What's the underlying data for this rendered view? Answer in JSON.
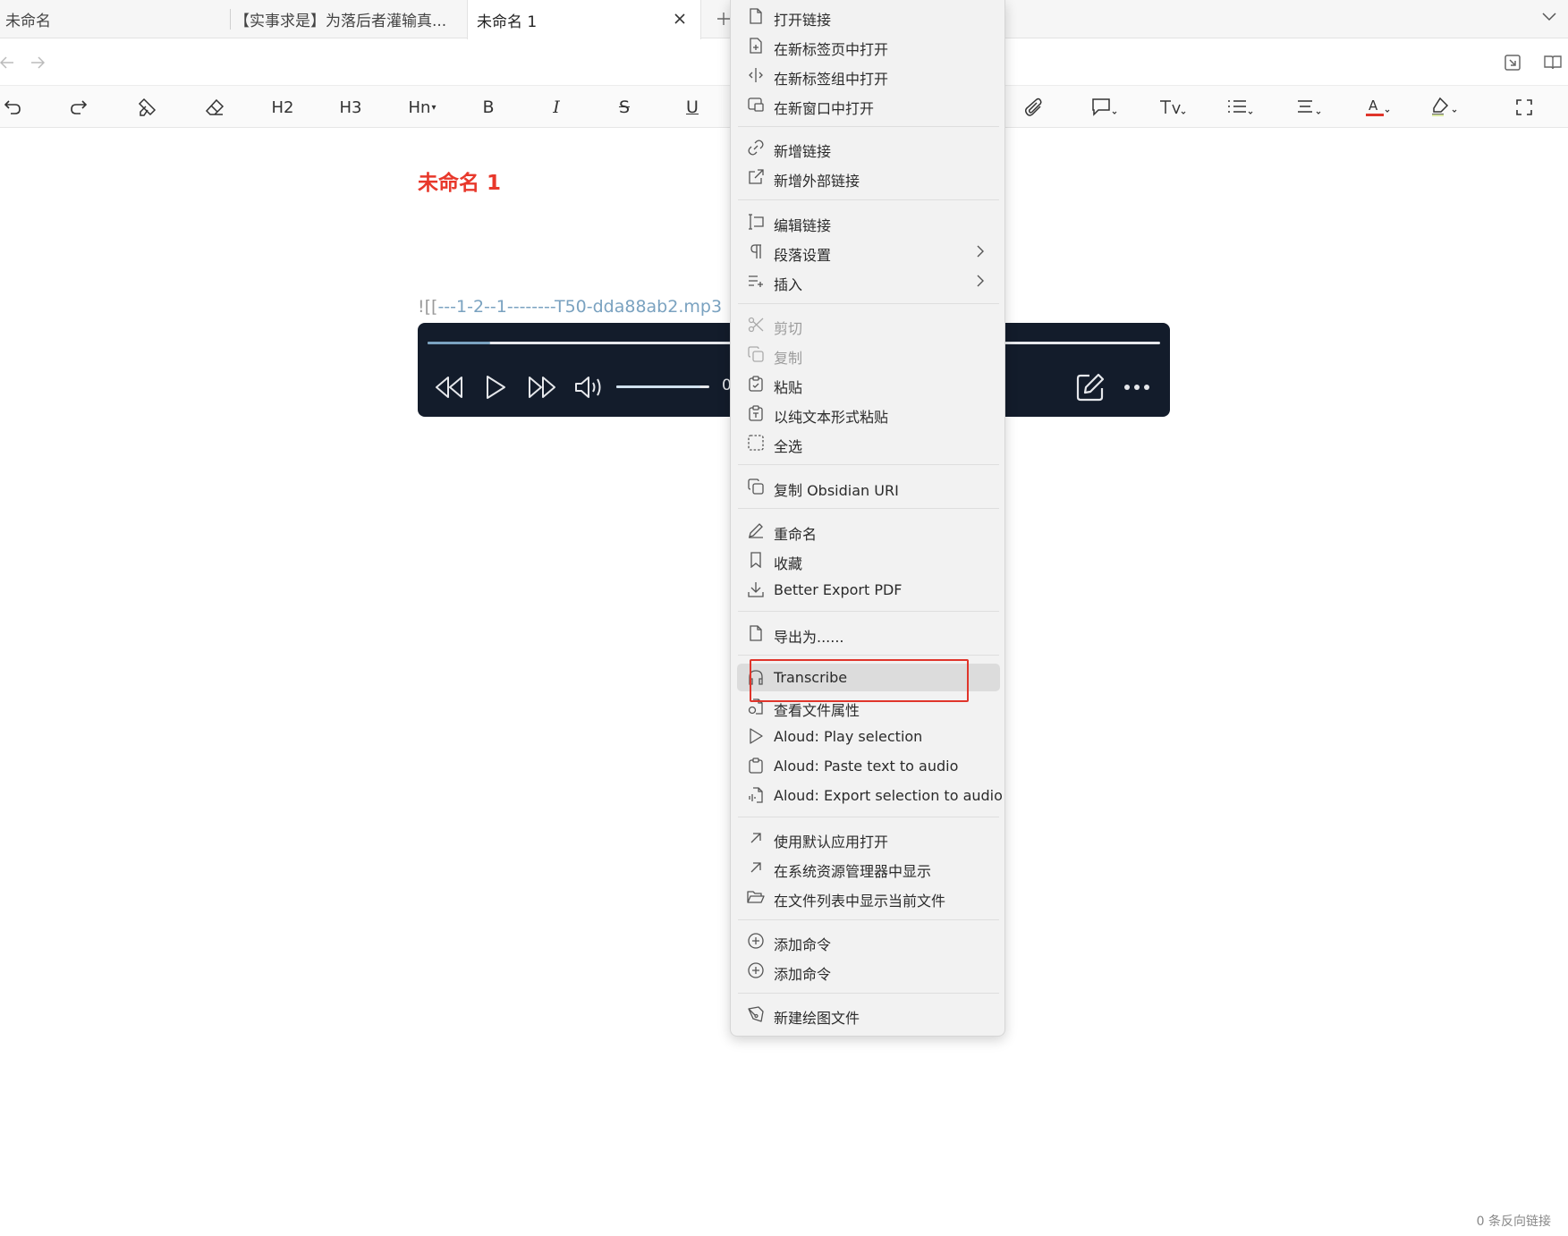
{
  "tabs": [
    {
      "label": "未命名",
      "active": false
    },
    {
      "label": "【实事求是】为落后者灌输真...",
      "active": false
    },
    {
      "label": "未命名 1",
      "active": true
    }
  ],
  "document": {
    "title": "未命名 1",
    "embed_prefix": "![[",
    "embed_text": "---1-2--1--------T50-dda88ab2.mp3",
    "title_color": "#e8382b"
  },
  "toolbar": {
    "h2": "H2",
    "h3": "H3",
    "hn": "Hn",
    "bold": "B",
    "italic": "I",
    "strike": "S",
    "underline": "U",
    "font_color_letter": "A"
  },
  "player": {
    "progress": 0.085,
    "volume": 0.9,
    "time_text": "0"
  },
  "context_menu": {
    "items": [
      {
        "label": "打开链接",
        "icon": "file-icon"
      },
      {
        "label": "在新标签页中打开",
        "icon": "file-plus-icon"
      },
      {
        "label": "在新标签组中打开",
        "icon": "split-icon"
      },
      {
        "label": "在新窗口中打开",
        "icon": "window-icon"
      },
      {
        "label": "新增链接",
        "icon": "link-icon"
      },
      {
        "label": "新增外部链接",
        "icon": "external-link-icon"
      },
      {
        "label": "编辑链接",
        "icon": "text-cursor-icon"
      },
      {
        "label": "段落设置",
        "icon": "pilcrow-icon"
      },
      {
        "label": "插入",
        "icon": "list-plus-icon"
      },
      {
        "label": "剪切",
        "icon": "scissors-icon"
      },
      {
        "label": "复制",
        "icon": "copy-icon"
      },
      {
        "label": "粘贴",
        "icon": "clipboard-icon"
      },
      {
        "label": "以纯文本形式粘贴",
        "icon": "clipboard-type-icon"
      },
      {
        "label": "全选",
        "icon": "select-all-icon"
      },
      {
        "label": "复制 Obsidian URI",
        "icon": "copy-icon"
      },
      {
        "label": "重命名",
        "icon": "pencil-icon"
      },
      {
        "label": "收藏",
        "icon": "bookmark-icon"
      },
      {
        "label": "Better Export PDF",
        "icon": "download-icon"
      },
      {
        "label": "导出为......",
        "icon": "file-icon"
      },
      {
        "label": "Transcribe",
        "icon": "headphones-icon"
      },
      {
        "label": "查看文件属性",
        "icon": "file-info-icon"
      },
      {
        "label": "Aloud: Play selection",
        "icon": "play-icon"
      },
      {
        "label": "Aloud: Paste text to audio",
        "icon": "clipboard-icon"
      },
      {
        "label": "Aloud: Export selection to audio",
        "icon": "file-audio-icon"
      },
      {
        "label": "使用默认应用打开",
        "icon": "arrow-up-right-icon"
      },
      {
        "label": "在系统资源管理器中显示",
        "icon": "arrow-up-right-icon"
      },
      {
        "label": "在文件列表中显示当前文件",
        "icon": "folder-open-icon"
      },
      {
        "label": "添加命令",
        "icon": "plus-circle-icon"
      },
      {
        "label": "添加命令",
        "icon": "plus-circle-icon"
      },
      {
        "label": "新建绘图文件",
        "icon": "pen-tool-icon"
      }
    ]
  },
  "status": {
    "backlinks": "0 条反向链接"
  },
  "colors": {
    "highlight_box": "#e0352b",
    "player_bg": "#131c2b",
    "font_color_underline": "#e0352b"
  }
}
